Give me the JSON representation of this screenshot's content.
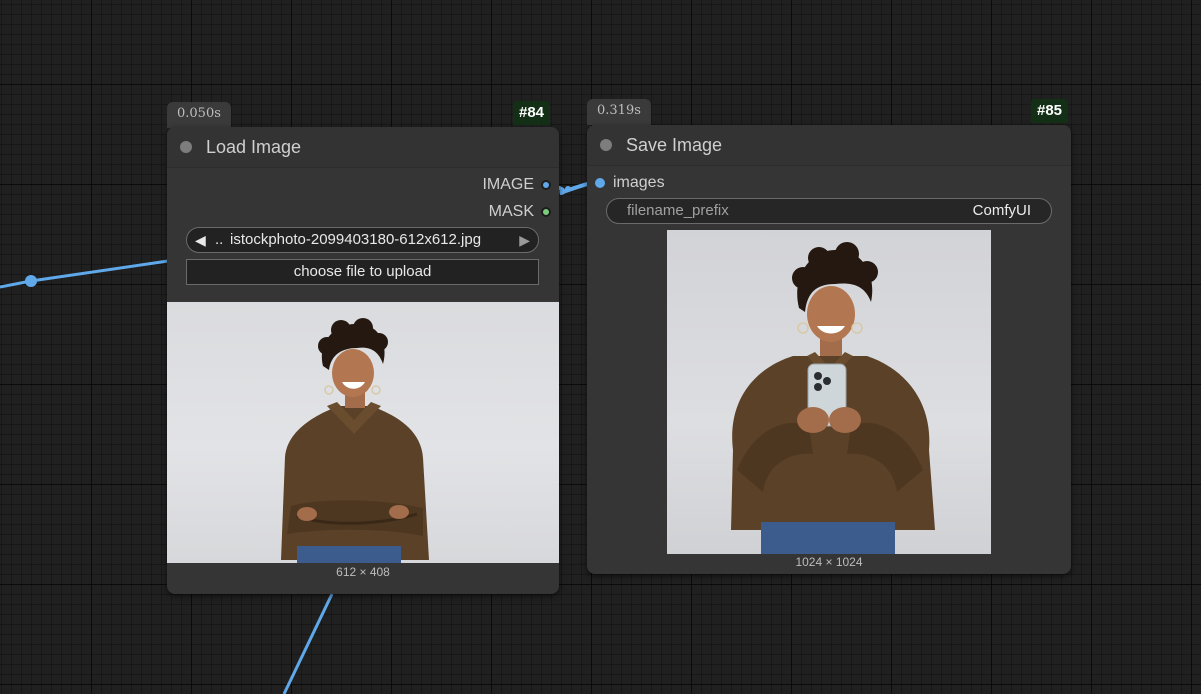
{
  "canvas": {
    "background_color": "#202020",
    "link_color": "#5fa8ea"
  },
  "nodes": [
    {
      "id_label": "#84",
      "exec_time": "0.050s",
      "title": "Load Image",
      "outputs": [
        {
          "label": "IMAGE",
          "icon": "image-output-slot-icon",
          "color": "#5fa8ea"
        },
        {
          "label": "MASK",
          "icon": "mask-output-slot-icon",
          "color": "#7cce7c"
        }
      ],
      "widgets": {
        "image_combo": {
          "prefix": "..",
          "value": "istockphoto-2099403180-612x612.jpg",
          "prev_icon": "triangle-left-icon",
          "next_icon": "triangle-right-icon"
        },
        "upload_button": "choose file to upload"
      },
      "preview": {
        "alt": "woman with crossed arms photo",
        "dimensions": "612 × 408"
      }
    },
    {
      "id_label": "#85",
      "exec_time": "0.319s",
      "title": "Save Image",
      "inputs": [
        {
          "label": "images",
          "icon": "images-input-slot-icon",
          "color": "#5fa8ea"
        }
      ],
      "widgets": {
        "filename_prefix": {
          "label": "filename_prefix",
          "value": "ComfyUI"
        }
      },
      "preview": {
        "alt": "woman holding phone photo",
        "dimensions": "1024 × 1024"
      }
    }
  ]
}
